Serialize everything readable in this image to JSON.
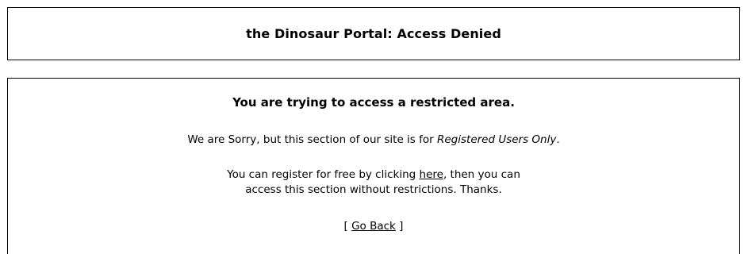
{
  "header": {
    "title": "the Dinosaur Portal: Access Denied"
  },
  "notice": {
    "heading": "You are trying to access a restricted area.",
    "sorry_prefix": "We are Sorry, but this section of our site is for ",
    "sorry_emphasis": "Registered Users Only",
    "sorry_suffix": ".",
    "register_prefix": "You can register for free by clicking ",
    "register_link": "here",
    "register_suffix": ", then you can",
    "register_line2": "access this section without restrictions. Thanks.",
    "back_open": "[ ",
    "back_link": "Go Back",
    "back_close": " ]"
  }
}
